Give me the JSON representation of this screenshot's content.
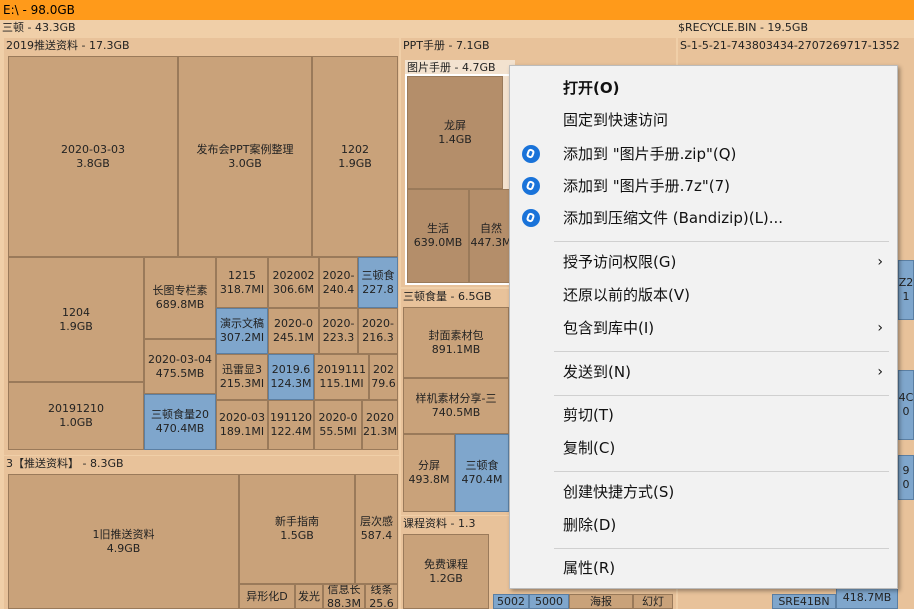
{
  "title": "E:\\ - 98.0GB",
  "groups": {
    "g1": "三顿 - 43.3GB",
    "g2": "2019推送资料 - 17.3GB",
    "g3": "3【推送资料】 - 8.3GB",
    "g4": "PPT手册 - 7.1GB",
    "g5": "图片手册 - 4.7GB",
    "g6": "三顿食量 - 6.5GB",
    "g7": "课程资料 - 1.3",
    "g8": "$RECYCLE.BIN - 19.5GB",
    "g9": "S-1-5-21-743803434-2707269717-1352"
  },
  "tiles": {
    "t1": [
      "2020-03-03",
      "3.8GB"
    ],
    "t2": [
      "发布会PPT案例整理",
      "3.0GB"
    ],
    "t3": [
      "1202",
      "1.9GB"
    ],
    "t4": [
      "1204",
      "1.9GB"
    ],
    "t5": [
      "长图专栏素",
      "689.8MB"
    ],
    "t6": [
      "1215",
      "318.7MI"
    ],
    "t7": [
      "202002",
      "306.6M"
    ],
    "t8": [
      "2020-",
      "240.4"
    ],
    "t9": [
      "三顿食",
      "227.8"
    ],
    "t10": [
      "演示文稿",
      "307.2MI"
    ],
    "t11": [
      "2020-0",
      "245.1M"
    ],
    "t12": [
      "2020-",
      "223.3"
    ],
    "t13": [
      "2020-",
      "216.3"
    ],
    "t14": [
      "2020-03-04",
      "475.5MB"
    ],
    "t15": [
      "迅雷显3",
      "215.3MI"
    ],
    "t16": [
      "2019.6",
      "124.3M"
    ],
    "t17": [
      "2019111",
      "115.1MI"
    ],
    "t18": [
      "202",
      "79.6"
    ],
    "t19": [
      "20191210",
      "1.0GB"
    ],
    "t20": [
      "三顿食量20",
      "470.4MB"
    ],
    "t21": [
      "2020-03",
      "189.1MI"
    ],
    "t22": [
      "191120",
      "122.4M"
    ],
    "t23": [
      "2020-0",
      "55.5MI"
    ],
    "t24": [
      "2020",
      "21.3M"
    ],
    "t25": [
      "1旧推送资料",
      "4.9GB"
    ],
    "t26": [
      "新手指南",
      "1.5GB"
    ],
    "t27": [
      "层次感",
      "587.4"
    ],
    "t28": [
      "发光",
      ""
    ],
    "t29": [
      "信息长",
      "88.3M"
    ],
    "t30": [
      "线条",
      "25.6"
    ],
    "t31": [
      "异形化D",
      ""
    ],
    "t32": [
      "龙屏",
      "1.4GB"
    ],
    "t33": [
      "生活",
      "639.0MB"
    ],
    "t34": [
      "自然",
      "447.3M"
    ],
    "t35": [
      "封面素材包",
      "891.1MB"
    ],
    "t36": [
      "样机素材分享-三",
      "740.5MB"
    ],
    "t37": [
      "分屏",
      "493.8M"
    ],
    "t38": [
      "三顿食",
      "470.4M"
    ],
    "t39": [
      "免费课程",
      "1.2GB"
    ],
    "t40": [
      "5002",
      ""
    ],
    "t41": [
      "5000",
      ""
    ],
    "t42": [
      "海报",
      ""
    ],
    "t43": [
      "幻灯",
      ""
    ],
    "t44": [
      "418.7MB",
      ""
    ],
    "t45": [
      "SRE41BN",
      ""
    ],
    "t46": [
      "Z2",
      "1"
    ],
    "t47": [
      "4C",
      "0"
    ],
    "t48": [
      "9",
      "0"
    ]
  },
  "menu": {
    "open": "打开(O)",
    "pin": "固定到快速访问",
    "add_zip": "添加到 \"图片手册.zip\"(Q)",
    "add_7z": "添加到 \"图片手册.7z\"(7)",
    "add_archive": "添加到压缩文件 (Bandizip)(L)...",
    "grant": "授予访问权限(G)",
    "restore": "还原以前的版本(V)",
    "library": "包含到库中(I)",
    "send": "发送到(N)",
    "cut": "剪切(T)",
    "copy": "复制(C)",
    "shortcut": "创建快捷方式(S)",
    "delete": "删除(D)",
    "props": "属性(R)",
    "submenu_arrow": "›"
  },
  "colors": {
    "titlebar": "#ff9a1a",
    "folder": "#c9a27a",
    "highlight": "#7fa6cc"
  }
}
